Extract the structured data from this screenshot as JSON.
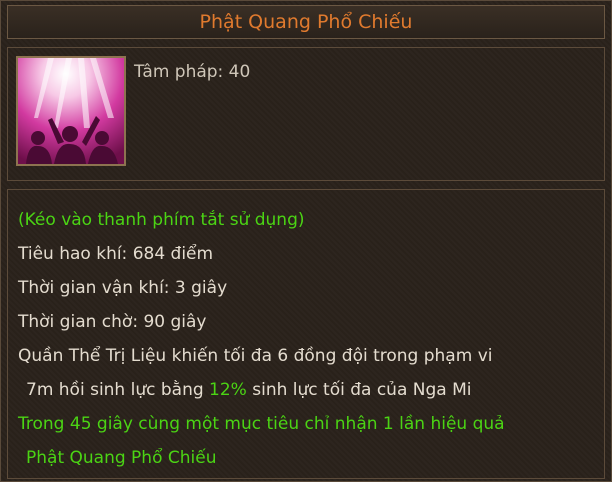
{
  "tooltip": {
    "title": "Phật Quang Phổ Chiếu",
    "icon": "phat-quang-pho-chieu-skill-icon",
    "stat": "Tâm pháp: 40",
    "lines": {
      "drag_hint": "(Kéo vào thanh phím tắt sử dụng)",
      "energy_cost": "Tiêu hao khí: 684 điểm",
      "cast_time": "Thời gian vận khí: 3 giây",
      "cooldown": "Thời gian chờ: 90 giây",
      "effect_1": "Quần Thể Trị Liệu khiến tối đa 6 đồng đội trong phạm vi",
      "effect_2_a": "7m hồi sinh lực bằng ",
      "effect_2_pct": "12%",
      "effect_2_b": " sinh lực tối đa của Nga Mi",
      "limit_1": "Trong 45 giây cùng một mục tiêu chỉ nhận 1 lần hiệu quả",
      "limit_2": "Phật Quang Phổ Chiếu"
    }
  },
  "colors": {
    "title": "#e07a2e",
    "green_text": "#4bd414",
    "normal_text": "#e4dccf"
  }
}
